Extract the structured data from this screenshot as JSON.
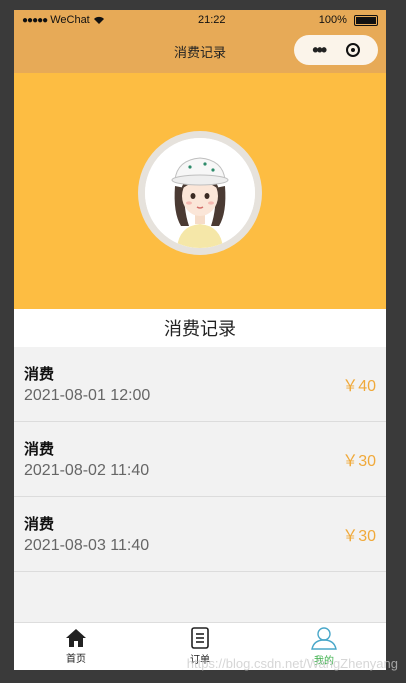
{
  "status_bar": {
    "carrier": "WeChat",
    "time": "21:22",
    "battery": "100%"
  },
  "nav": {
    "title": "消费记录"
  },
  "section": {
    "title": "消费记录"
  },
  "records": [
    {
      "type": "消费",
      "time": "2021-08-01 12:00",
      "amount": "￥40"
    },
    {
      "type": "消费",
      "time": "2021-08-02 11:40",
      "amount": "￥30"
    },
    {
      "type": "消费",
      "time": "2021-08-03 11:40",
      "amount": "￥30"
    }
  ],
  "tabs": [
    {
      "label": "首页",
      "icon": "home-icon"
    },
    {
      "label": "订单",
      "icon": "order-icon"
    },
    {
      "label": "我的",
      "icon": "user-icon"
    }
  ],
  "watermark": "https://blog.csdn.net/WangZhenyang",
  "colors": {
    "nav": "#e7aa57",
    "banner": "#fdbd42",
    "amount": "#f0a93a",
    "active_tab": "#3bb04a"
  }
}
